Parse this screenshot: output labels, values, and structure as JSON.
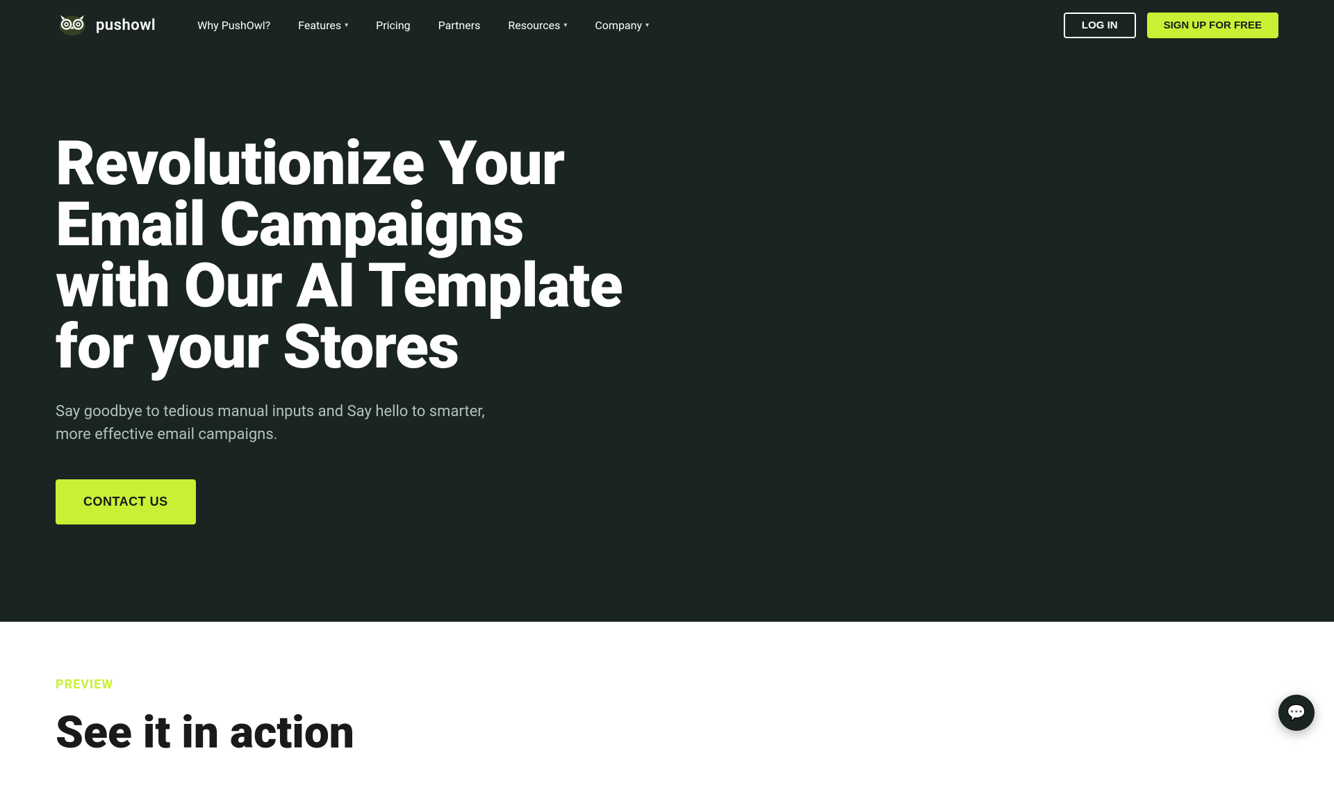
{
  "brand": {
    "name": "pushowl",
    "logo_alt": "PushOwl logo"
  },
  "navbar": {
    "logo_text": "pushowl",
    "nav_items": [
      {
        "label": "Why PushOwl?",
        "has_dropdown": false
      },
      {
        "label": "Features",
        "has_dropdown": true
      },
      {
        "label": "Pricing",
        "has_dropdown": false
      },
      {
        "label": "Partners",
        "has_dropdown": false
      },
      {
        "label": "Resources",
        "has_dropdown": true
      },
      {
        "label": "Company",
        "has_dropdown": true
      }
    ],
    "login_label": "LOG IN",
    "signup_label": "SIGN UP FOR FREE"
  },
  "hero": {
    "title": "Revolutionize Your Email Campaigns with Our AI Template for your Stores",
    "subtitle": "Say goodbye to tedious manual inputs and Say hello to smarter, more effective email campaigns.",
    "cta_label": "CONTACT US"
  },
  "preview": {
    "section_label": "PREVIEW",
    "section_title": "See it in action"
  },
  "colors": {
    "background_dark": "#1a2420",
    "accent_green": "#c8f135",
    "text_white": "#ffffff",
    "text_muted": "#b0c4bb",
    "text_dark": "#1a1a1a"
  }
}
